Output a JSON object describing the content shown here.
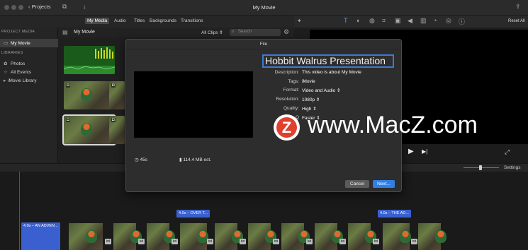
{
  "titlebar": {
    "back_label": "Projects",
    "title": "My Movie"
  },
  "media_tabs": [
    "My Media",
    "Audio",
    "Titles",
    "Backgrounds",
    "Transitions"
  ],
  "viewer_tools": {
    "reset_label": "Reset All"
  },
  "sidebar": {
    "project_media_heading": "PROJECT MEDIA",
    "project_item": "My Movie",
    "libraries_heading": "LIBRARIES",
    "library_items": [
      "Photos",
      "All Events",
      "iMovie Library"
    ]
  },
  "browser": {
    "title": "My Movie",
    "filter": "All Clips",
    "search_placeholder": "Search"
  },
  "timeline": {
    "settings_label": "Settings",
    "titles": [
      "4.0s – AN ADVEN...",
      "4.0s – OVER T...",
      "4.0s – THE AD..."
    ]
  },
  "dialog": {
    "header": "File",
    "title_value": "Hobbit Walrus Presentation",
    "fields": {
      "description": {
        "label": "Description:",
        "value": "This video is about My Movie"
      },
      "tags": {
        "label": "Tags:",
        "value": "iMovie"
      },
      "format": {
        "label": "Format:",
        "value": "Video and Audio"
      },
      "resolution": {
        "label": "Resolution:",
        "value": "1080p"
      },
      "quality": {
        "label": "Quality:",
        "value": "High"
      },
      "compress": {
        "label": "Q",
        "value": "Faster"
      }
    },
    "duration": "45s",
    "size": "114.4 MB est.",
    "cancel_label": "Cancel",
    "next_label": "Next..."
  },
  "watermark": {
    "logo_letter": "Z",
    "text": "www.MacZ.com"
  },
  "colors": {
    "accent": "#3a5fcf",
    "primary_button": "#2f7fe6",
    "audio_clip": "#1a5a1a"
  }
}
